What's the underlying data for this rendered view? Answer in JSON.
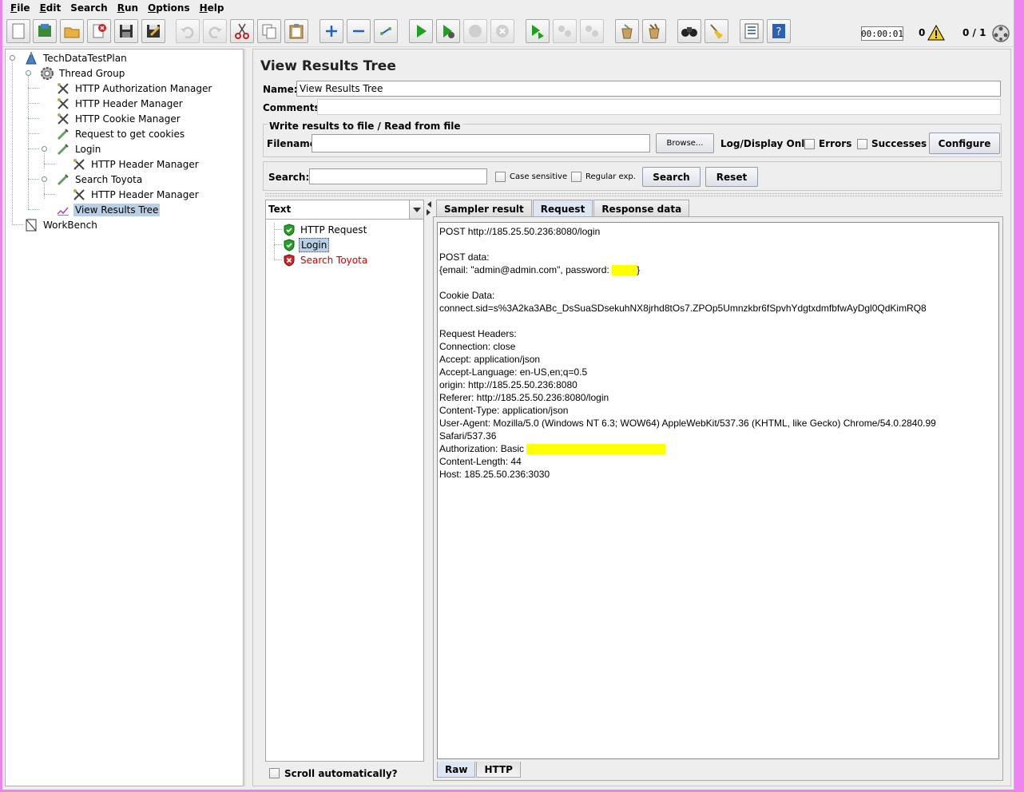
{
  "menu": [
    {
      "mnemonic": "F",
      "rest": "ile"
    },
    {
      "mnemonic": "E",
      "rest": "dit"
    },
    {
      "mnemonic": "",
      "rest": "Search"
    },
    {
      "mnemonic": "R",
      "rest": "un"
    },
    {
      "mnemonic": "O",
      "rest": "ptions"
    },
    {
      "mnemonic": "H",
      "rest": "elp"
    }
  ],
  "toolbar": {
    "timer": "00:00:01",
    "error_count": "0",
    "threads": "0 / 1",
    "buttons": [
      "new-icon",
      "templates-icon",
      "open-icon",
      "close-icon",
      "save-icon",
      "save-as-icon",
      "undo-icon",
      "redo-icon",
      "cut-icon",
      "copy-icon",
      "paste-icon",
      "expand-icon",
      "collapse-icon",
      "toggle-icon",
      "start-icon",
      "start-no-pause-icon",
      "stop-icon",
      "shutdown-icon",
      "remote-start-icon",
      "remote-stop-icon",
      "remote-shutdown-icon",
      "clear-icon",
      "clear-all-icon",
      "search-icon",
      "reset-search-icon",
      "function-helper-icon",
      "help-icon"
    ]
  },
  "tree": {
    "items": [
      {
        "label": "TechDataTestPlan",
        "icon": "test-plan-icon"
      },
      {
        "label": "Thread Group",
        "icon": "thread-group-icon"
      },
      {
        "label": "HTTP Authorization Manager",
        "icon": "config-tool-icon"
      },
      {
        "label": "HTTP Header Manager",
        "icon": "config-tool-icon"
      },
      {
        "label": "HTTP Cookie Manager",
        "icon": "config-tool-icon"
      },
      {
        "label": "Request to get cookies",
        "icon": "sampler-icon"
      },
      {
        "label": "Login",
        "icon": "sampler-icon"
      },
      {
        "label": "HTTP Header Manager",
        "icon": "config-tool-icon"
      },
      {
        "label": "Search Toyota",
        "icon": "sampler-icon"
      },
      {
        "label": "HTTP Header Manager",
        "icon": "config-tool-icon"
      },
      {
        "label": "View Results Tree",
        "icon": "listener-icon"
      },
      {
        "label": "WorkBench",
        "icon": "workbench-icon"
      }
    ]
  },
  "panel": {
    "title": "View Results Tree",
    "name_label": "Name:",
    "name_value": "View Results Tree",
    "comments_label": "Comments:",
    "file_group_title": "Write results to file / Read from file",
    "filename_label": "Filename",
    "browse_label": "Browse...",
    "log_display_label": "Log/Display Only:",
    "errors_label": "Errors",
    "successes_label": "Successes",
    "configure_label": "Configure",
    "search_label": "Search:",
    "case_sensitive_label": "Case sensitive",
    "regular_exp_label": "Regular exp.",
    "search_button": "Search",
    "reset_button": "Reset"
  },
  "results": {
    "renderer": "Text",
    "items": [
      {
        "label": "HTTP Request",
        "status": "success"
      },
      {
        "label": "Login",
        "status": "success"
      },
      {
        "label": "Search Toyota",
        "status": "fail"
      }
    ],
    "scroll_label": "Scroll automatically?"
  },
  "tabs": [
    "Sampler result",
    "Request",
    "Response data"
  ],
  "bottom_tabs": [
    "Raw",
    "HTTP"
  ],
  "request": {
    "lines": [
      "POST http://185.25.50.236:8080/login",
      "",
      "POST data:",
      "{email: \"admin@admin.com\", password: ",
      "",
      "Cookie Data:",
      "connect.sid=s%3A2ka3ABc_DsSuaSDsekuhNX8jrhd8tOs7.ZPOp5Umnzkbr6fSpvhYdgtxdmfbfwAyDgl0QdKimRQ8",
      "",
      "Request Headers:",
      "Connection: close",
      "Accept: application/json",
      "Accept-Language: en-US,en;q=0.5",
      "origin: http://185.25.50.236:8080",
      "Referer: http://185.25.50.236:8080/login",
      "Content-Type: application/json",
      "User-Agent: Mozilla/5.0 (Windows NT 6.3; WOW64) AppleWebKit/537.36 (KHTML, like Gecko) Chrome/54.0.2840.99",
      "Safari/537.36",
      "Authorization: Basic ",
      "Content-Length: 44",
      "Host: 185.25.50.236:3030"
    ],
    "password_suffix": "}",
    "highlight_color": "#ffff00"
  }
}
